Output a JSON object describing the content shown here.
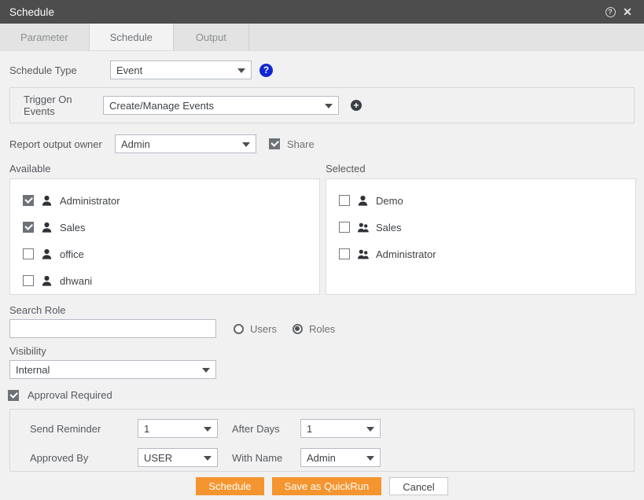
{
  "window": {
    "title": "Schedule",
    "help_icon": "help-circle-icon",
    "close_icon": "close-icon",
    "close_glyph": "✕",
    "help_glyph": "?"
  },
  "tabs": [
    {
      "label": "Parameter",
      "active": false
    },
    {
      "label": "Schedule",
      "active": true
    },
    {
      "label": "Output",
      "active": false
    }
  ],
  "schedule_type": {
    "label": "Schedule Type",
    "value": "Event",
    "help_glyph": "?"
  },
  "trigger": {
    "label": "Trigger On Events",
    "value": "Create/Manage Events",
    "add_glyph": "+"
  },
  "report_owner": {
    "label": "Report output owner",
    "value": "Admin",
    "share_label": "Share",
    "share_checked": true
  },
  "available": {
    "label": "Available",
    "items": [
      {
        "name": "Administrator",
        "checked": true,
        "icon": "user-icon"
      },
      {
        "name": "Sales",
        "checked": true,
        "icon": "user-icon"
      },
      {
        "name": "office",
        "checked": false,
        "icon": "user-icon"
      },
      {
        "name": "dhwani",
        "checked": false,
        "icon": "user-icon"
      }
    ]
  },
  "selected": {
    "label": "Selected",
    "items": [
      {
        "name": "Demo",
        "checked": false,
        "icon": "user-icon"
      },
      {
        "name": "Sales",
        "checked": false,
        "icon": "user-group-icon"
      },
      {
        "name": "Administrator",
        "checked": false,
        "icon": "user-group-icon"
      }
    ]
  },
  "search_role": {
    "label": "Search Role",
    "value": "",
    "placeholder": "",
    "users_label": "Users",
    "roles_label": "Roles",
    "selected_mode": "Roles"
  },
  "visibility": {
    "label": "Visibility",
    "value": "Internal"
  },
  "approval": {
    "label": "Approval Required",
    "checked": true,
    "send_reminder_label": "Send Reminder",
    "send_reminder_value": "1",
    "after_days_label": "After Days",
    "after_days_value": "1",
    "approved_by_label": "Approved By",
    "approved_by_value": "USER",
    "with_name_label": "With Name",
    "with_name_value": "Admin"
  },
  "footer": {
    "schedule_label": "Schedule",
    "quickrun_label": "Save as QuickRun",
    "cancel_label": "Cancel"
  },
  "colors": {
    "titlebar": "#4d4d4d",
    "accent_orange": "#f4952f",
    "help_blue": "#1226d4",
    "background": "#f1f1f1"
  }
}
